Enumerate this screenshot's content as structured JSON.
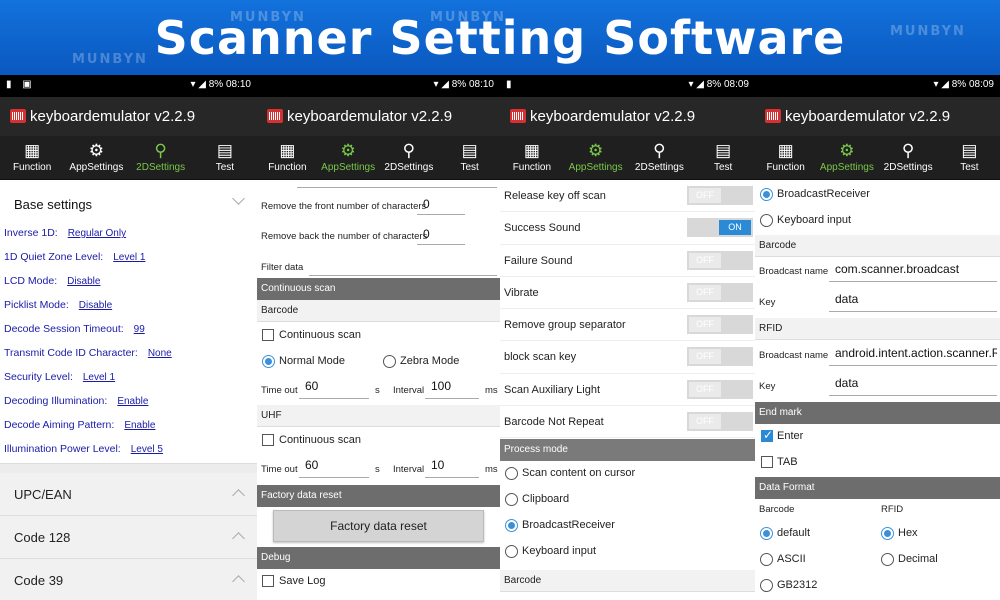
{
  "banner": {
    "title": "Scanner Setting Software",
    "watermark": "MUNBYN"
  },
  "status": {
    "times": [
      "08:10",
      "08:10",
      "08:09",
      "08:09"
    ],
    "battery": "8%"
  },
  "app": {
    "title": "keyboardemulator v2.2.9"
  },
  "tabs": [
    {
      "label": "Function",
      "icon": "grid-icon"
    },
    {
      "label": "AppSettings",
      "icon": "gear-icon"
    },
    {
      "label": "2DSettings",
      "icon": "link-icon"
    },
    {
      "label": "Test",
      "icon": "calculator-icon"
    }
  ],
  "screen1": {
    "base_header": "Base settings",
    "settings": [
      {
        "label": "Inverse 1D:",
        "value": "Regular Only"
      },
      {
        "label": "1D Quiet Zone Level:",
        "value": "Level 1"
      },
      {
        "label": "LCD Mode:",
        "value": "Disable"
      },
      {
        "label": "Picklist Mode:",
        "value": "Disable"
      },
      {
        "label": "Decode Session Timeout:",
        "value": "99"
      },
      {
        "label": "Transmit Code ID Character:",
        "value": "None"
      },
      {
        "label": "Security Level:",
        "value": "Level 1"
      },
      {
        "label": "Decoding Illumination:",
        "value": "Enable"
      },
      {
        "label": "Decode Aiming Pattern:",
        "value": "Enable"
      },
      {
        "label": "Illumination Power Level:",
        "value": "Level 5"
      }
    ],
    "sections": [
      "UPC/EAN",
      "Code 128",
      "Code 39"
    ]
  },
  "screen2": {
    "front_label": "Remove the front number of characters",
    "front_value": "0",
    "back_label": "Remove back the number of characters",
    "back_value": "0",
    "filter_label": "Filter data",
    "continuous_header": "Continuous scan",
    "barcode_header": "Barcode",
    "continuous_label": "Continuous scan",
    "normal_mode": "Normal Mode",
    "zebra_mode": "Zebra Mode",
    "timeout_label": "Time out",
    "timeout_value": "60",
    "unit_s": "s",
    "interval_label": "Interval",
    "interval_value": "100",
    "unit_ms": "ms",
    "uhf_header": "UHF",
    "uhf_continuous_label": "Continuous scan",
    "uhf_timeout_value": "60",
    "uhf_interval_value": "10",
    "factory_header": "Factory data reset",
    "factory_button": "Factory data reset",
    "debug_header": "Debug",
    "save_log": "Save Log"
  },
  "screen3": {
    "toggles": [
      {
        "label": "Release key off scan",
        "state": "OFF"
      },
      {
        "label": "Success Sound",
        "state": "ON"
      },
      {
        "label": "Failure Sound",
        "state": "OFF"
      },
      {
        "label": "Vibrate",
        "state": "OFF"
      },
      {
        "label": "Remove group separator",
        "state": "OFF"
      },
      {
        "label": "block scan key",
        "state": "OFF"
      },
      {
        "label": "Scan Auxiliary Light",
        "state": "OFF"
      },
      {
        "label": "Barcode Not Repeat",
        "state": "OFF"
      }
    ],
    "process_header": "Process mode",
    "process_modes": [
      "Scan content on cursor",
      "Clipboard",
      "BroadcastReceiver",
      "Keyboard input"
    ],
    "barcode_header": "Barcode"
  },
  "screen4": {
    "modes": [
      "BroadcastReceiver",
      "Keyboard input"
    ],
    "barcode_header": "Barcode",
    "broadcast_label": "Broadcast name",
    "barcode_broadcast": "com.scanner.broadcast",
    "key_label": "Key",
    "barcode_key": "data",
    "rfid_header": "RFID",
    "rfid_broadcast": "android.intent.action.scanner.RF",
    "rfid_key": "data",
    "endmark_header": "End mark",
    "enter": "Enter",
    "tab": "TAB",
    "format_header": "Data Format",
    "format_barcode": "Barcode",
    "format_rfid": "RFID",
    "barcode_formats": [
      "default",
      "ASCII",
      "GB2312"
    ],
    "rfid_formats": [
      "Hex",
      "Decimal"
    ]
  },
  "colors": {
    "banner": "#0c63c9",
    "toggle_on": "#2a8ad6",
    "active_tab": "#7bc74a"
  }
}
